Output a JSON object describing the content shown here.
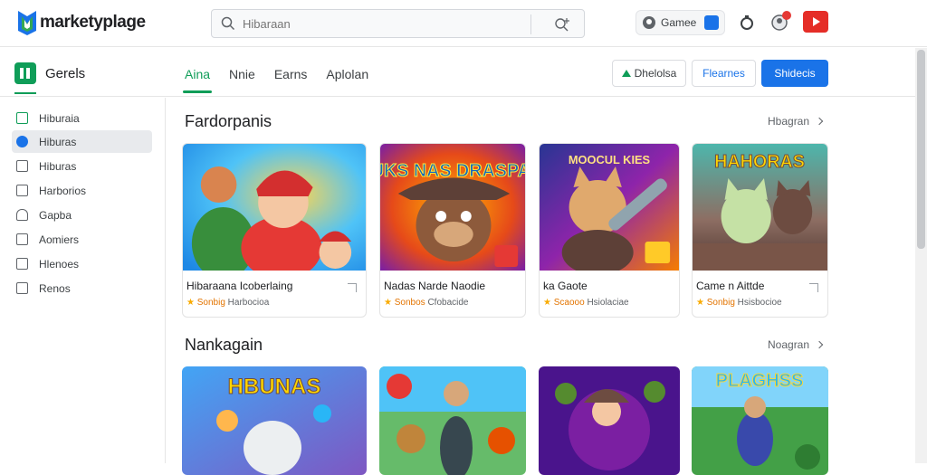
{
  "header": {
    "logo": "marketyplage",
    "search_placeholder": "Hibaraan",
    "account_label": "Gamee"
  },
  "subbar": {
    "apps_label": "Gerels",
    "tabs": [
      {
        "label": "Aina",
        "active": true
      },
      {
        "label": "Nnie",
        "active": false
      },
      {
        "label": "Earns",
        "active": false
      },
      {
        "label": "Aplolan",
        "active": false
      }
    ],
    "btn_outline_1": "Dhelolsa",
    "btn_outline_2": "Flearnes",
    "btn_primary": "Shidecis"
  },
  "sidebar": {
    "items": [
      {
        "label": "Hiburaia",
        "icon": "apps-icon",
        "active": false
      },
      {
        "label": "Hiburas",
        "icon": "games-icon",
        "active": true
      },
      {
        "label": "Hiburas",
        "icon": "movies-icon",
        "active": false
      },
      {
        "label": "Harborios",
        "icon": "books-icon",
        "active": false
      },
      {
        "label": "Gapba",
        "icon": "lock-icon",
        "active": false
      },
      {
        "label": "Aomiers",
        "icon": "list-icon",
        "active": false
      },
      {
        "label": "Hlenoes",
        "icon": "list-icon",
        "active": false
      },
      {
        "label": "Renos",
        "icon": "calendar-icon",
        "active": false
      }
    ]
  },
  "sections": [
    {
      "title": "Fardorpanis",
      "more": "Hbagran"
    },
    {
      "title": "Nankagain",
      "more": "Noagran"
    }
  ],
  "cards": [
    {
      "title": "Hibaraana Icoberlaing",
      "rating": "★",
      "rating_label": "Sonbig",
      "meta": "Harbocioa"
    },
    {
      "title": "Nadas Narde Naodie",
      "rating": "★",
      "rating_label": "Sonbos",
      "meta": "Cfobacide"
    },
    {
      "title": "ka Gaote",
      "rating": "★",
      "rating_label": "Scaooo",
      "meta": "Hsiolaciae"
    },
    {
      "title": "Came n Aittde",
      "rating": "★",
      "rating_label": "Sonbig",
      "meta": "Hsisbocioe"
    }
  ],
  "card_art_text": [
    "NUKS NAS DRASPAIS",
    "MOOCUL KIES",
    "HAHORAS",
    "HBUNAS",
    "PLAGHSS"
  ],
  "colors": {
    "accent_green": "#0f9d58",
    "primary_blue": "#1a73e8",
    "youtube_red": "#e52d27"
  }
}
